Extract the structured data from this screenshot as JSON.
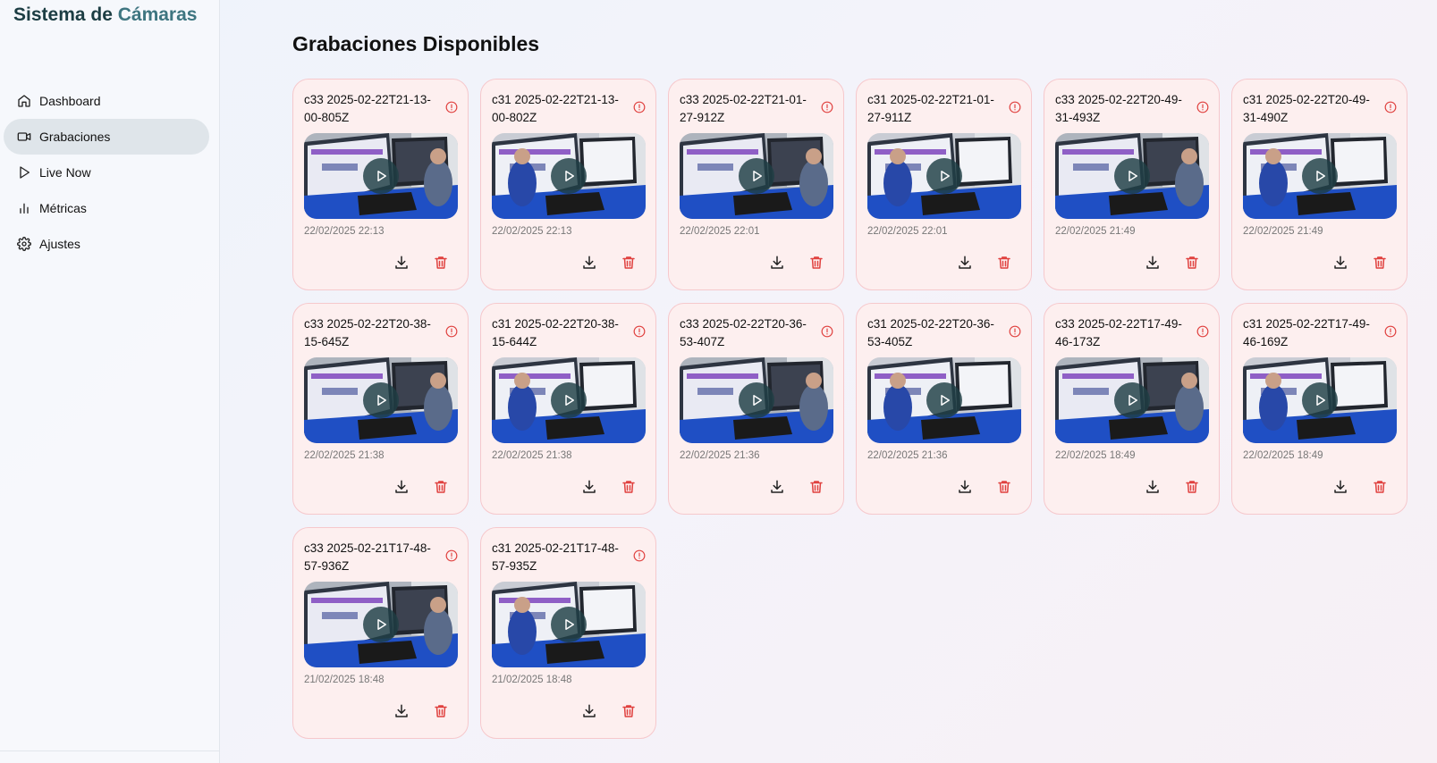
{
  "app": {
    "title_part1": "Sistema de ",
    "title_part2": "Cámaras",
    "accent_color": "#3e7580"
  },
  "sidebar": {
    "items": [
      {
        "label": "Dashboard",
        "icon": "home-icon",
        "active": false
      },
      {
        "label": "Grabaciones",
        "icon": "video-icon",
        "active": true
      },
      {
        "label": "Live Now",
        "icon": "play-icon",
        "active": false
      },
      {
        "label": "Métricas",
        "icon": "bar-chart-icon",
        "active": false
      },
      {
        "label": "Ajustes",
        "icon": "gear-icon",
        "active": false
      }
    ]
  },
  "main": {
    "title": "Grabaciones Disponibles",
    "recordings": [
      {
        "name": "c33 2025-02-22T21-13-00-805Z",
        "date": "22/02/2025 22:13"
      },
      {
        "name": "c31 2025-02-22T21-13-00-802Z",
        "date": "22/02/2025 22:13"
      },
      {
        "name": "c33 2025-02-22T21-01-27-912Z",
        "date": "22/02/2025 22:01"
      },
      {
        "name": "c31 2025-02-22T21-01-27-911Z",
        "date": "22/02/2025 22:01"
      },
      {
        "name": "c33 2025-02-22T20-49-31-493Z",
        "date": "22/02/2025 21:49"
      },
      {
        "name": "c31 2025-02-22T20-49-31-490Z",
        "date": "22/02/2025 21:49"
      },
      {
        "name": "c33 2025-02-22T20-38-15-645Z",
        "date": "22/02/2025 21:38"
      },
      {
        "name": "c31 2025-02-22T20-38-15-644Z",
        "date": "22/02/2025 21:38"
      },
      {
        "name": "c33 2025-02-22T20-36-53-407Z",
        "date": "22/02/2025 21:36"
      },
      {
        "name": "c31 2025-02-22T20-36-53-405Z",
        "date": "22/02/2025 21:36"
      },
      {
        "name": "c33 2025-02-22T17-49-46-173Z",
        "date": "22/02/2025 18:49"
      },
      {
        "name": "c31 2025-02-22T17-49-46-169Z",
        "date": "22/02/2025 18:49"
      },
      {
        "name": "c33 2025-02-21T17-48-57-936Z",
        "date": "21/02/2025 18:48"
      },
      {
        "name": "c31 2025-02-21T17-48-57-935Z",
        "date": "21/02/2025 18:48"
      }
    ],
    "icons": {
      "info": "alert-circle-icon",
      "download": "download-icon",
      "delete": "trash-icon",
      "play": "play-icon"
    },
    "colors": {
      "card_bg": "#fdefef",
      "card_border": "#f6c8cc",
      "delete": "#e0413f",
      "info": "#e0413f"
    }
  }
}
